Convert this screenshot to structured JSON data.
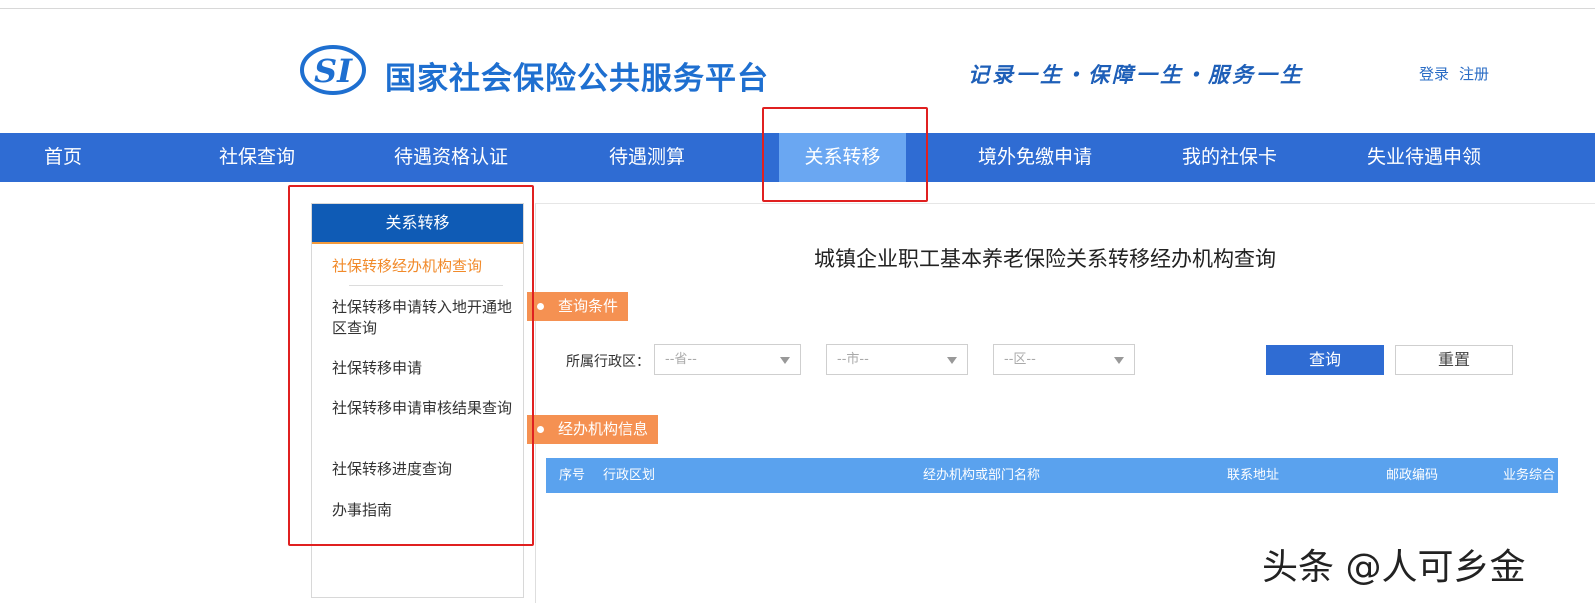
{
  "header": {
    "site_title": "国家社会保险公共服务平台",
    "slogan": "记录一生・保障一生・服务一生",
    "login": "登录",
    "register": "注册",
    "logo_icon": "si-logo"
  },
  "nav": {
    "items": [
      "首页",
      "社保查询",
      "待遇资格认证",
      "待遇测算",
      "关系转移",
      "境外免缴申请",
      "我的社保卡",
      "失业待遇申领"
    ],
    "active": "关系转移"
  },
  "sidebar": {
    "title": "关系转移",
    "items": [
      "社保转移经办机构查询",
      "社保转移申请转入地开通地区查询",
      "社保转移申请",
      "社保转移申请审核结果查询",
      "社保转移进度查询",
      "办事指南"
    ]
  },
  "main": {
    "title": "城镇企业职工基本养老保险关系转移经办机构查询",
    "query_section": "查询条件",
    "region_label": "所属行政区：",
    "province_placeholder": "--省--",
    "city_placeholder": "--市--",
    "district_placeholder": "--区--",
    "query_button": "查询",
    "reset_button": "重置",
    "info_section": "经办机构信息",
    "table_headers": [
      "序号",
      "行政区划",
      "经办机构或部门名称",
      "联系地址",
      "邮政编码",
      "业务综合"
    ]
  },
  "watermark": "头条 @人可乡金",
  "colors": {
    "nav_bg": "#2f6cd3",
    "nav_active": "#6aa7f2",
    "brand_blue": "#1e6fd0",
    "sidebar_head": "#0f5bb5",
    "accent_orange": "#f59152",
    "highlight_red": "#e02020",
    "table_head": "#5aa2ee"
  }
}
